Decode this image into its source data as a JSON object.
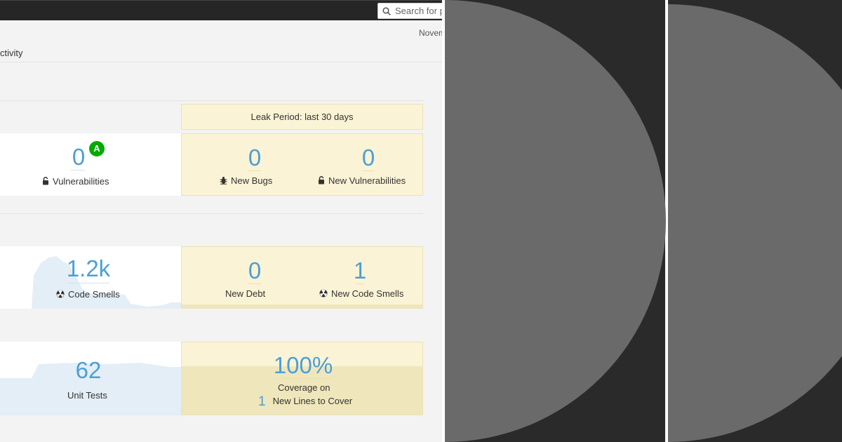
{
  "topbar": {
    "search_placeholder": "Search for p"
  },
  "page": {
    "date_partial": "Novem",
    "activity_partial": "ctivity"
  },
  "leak": {
    "header": "Leak Period: last 30 days"
  },
  "security": {
    "vulnerabilities_value": "0",
    "vulnerabilities_rating": "A",
    "vulnerabilities_label": "Vulnerabilities",
    "new_bugs_value": "0",
    "new_bugs_label": "New Bugs",
    "new_vulnerabilities_value": "0",
    "new_vulnerabilities_label": "New Vulnerabilities"
  },
  "maintainability": {
    "code_smells_value": "1.2k",
    "code_smells_label": "Code Smells",
    "new_debt_value": "0",
    "new_debt_label": "New Debt",
    "new_code_smells_value": "1",
    "new_code_smells_label": "New Code Smells"
  },
  "coverage": {
    "unit_tests_value": "62",
    "unit_tests_label": "Unit Tests",
    "coverage_value": "100%",
    "coverage_label": "Coverage on",
    "lines_to_cover_value": "1",
    "lines_to_cover_label": "New Lines to Cover"
  },
  "colors": {
    "topbar": "#262626",
    "page_bg": "#f3f3f3",
    "leak_bg": "#fbf3d5",
    "metric_blue": "#4b9fd5",
    "rating_a": "#00aa00",
    "deco_dark": "#2a2a2a",
    "deco_circle": "#6a6a6a"
  },
  "icons": [
    "search-icon",
    "lock-icon",
    "bug-icon",
    "code-smell-icon"
  ]
}
